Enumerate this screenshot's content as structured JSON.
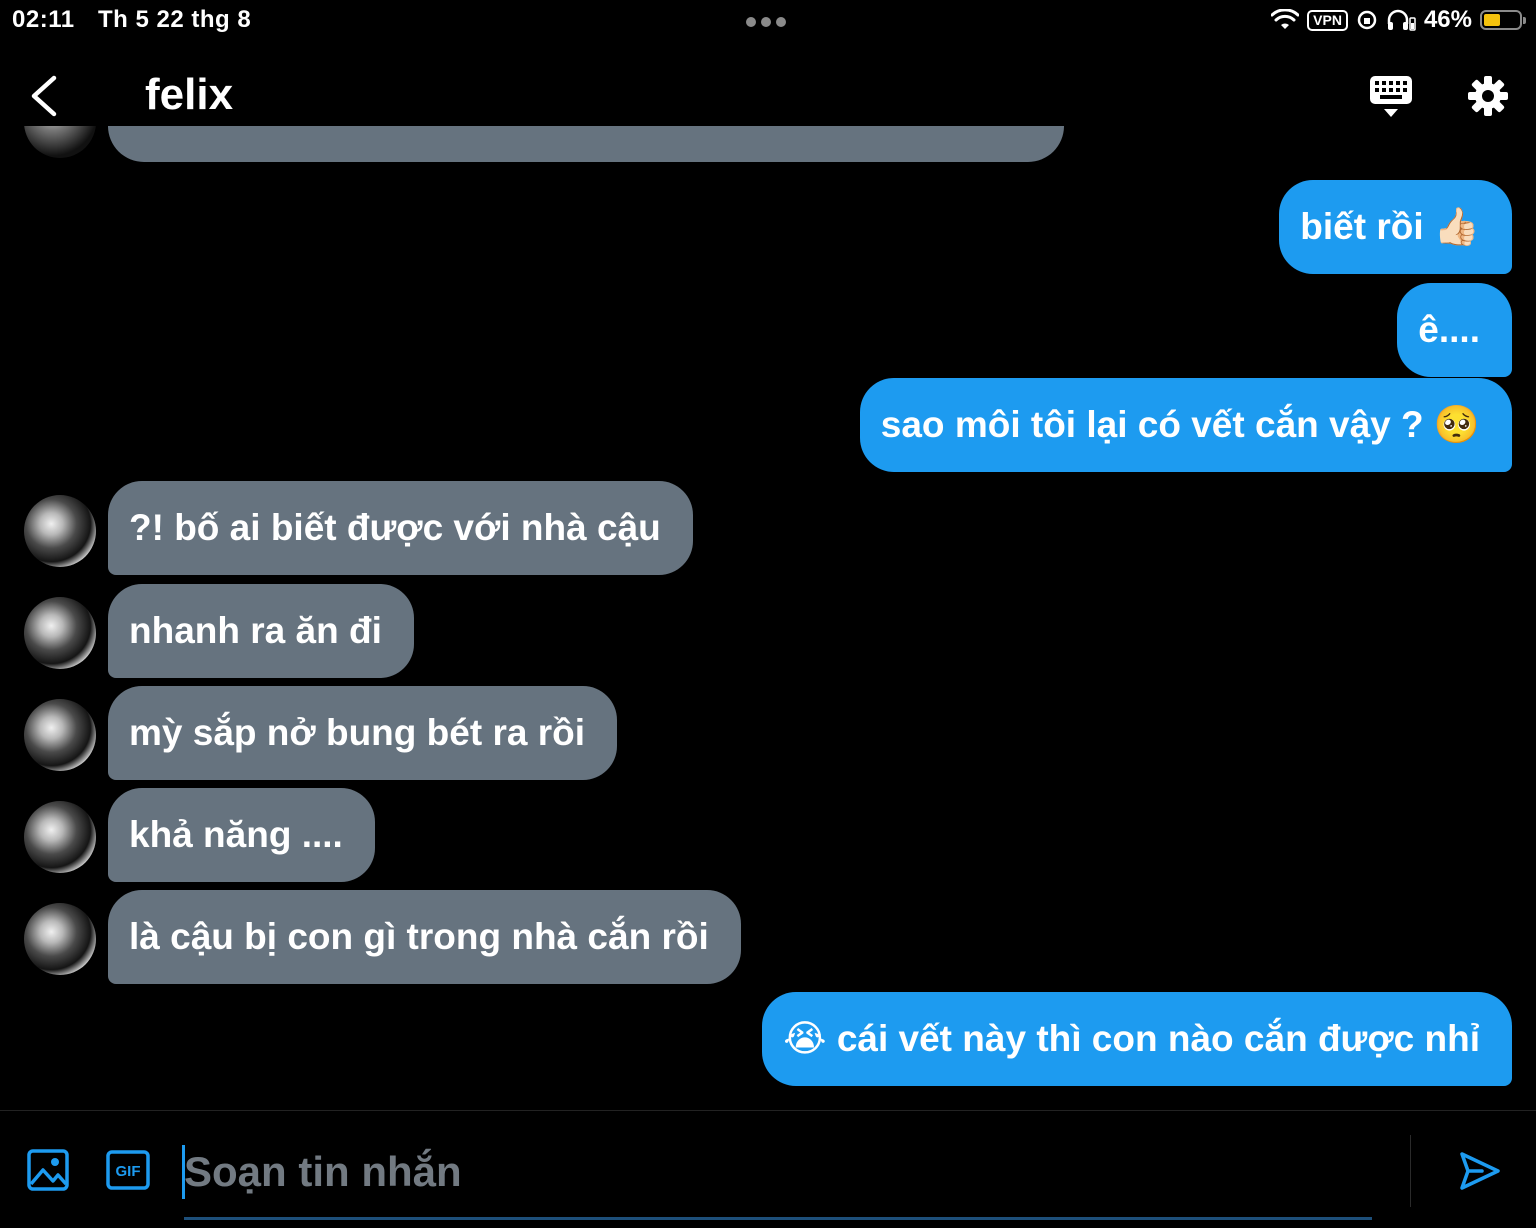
{
  "status_bar": {
    "time": "02:11",
    "date": "Th 5 22 thg 8",
    "vpn": "VPN",
    "battery_percent": "46%",
    "battery_level": 0.46
  },
  "header": {
    "title": "felix",
    "back_icon": "chevron-left-icon",
    "keyboard_icon": "keyboard-icon",
    "settings_icon": "gear-icon"
  },
  "messages": [
    {
      "direction": "out",
      "text": "biết rồi",
      "emoji": "👍🏻"
    },
    {
      "direction": "out",
      "text": "ê...."
    },
    {
      "direction": "out",
      "text": "sao môi tôi lại có vết cắn vậy ?",
      "emoji": "🥺"
    },
    {
      "direction": "in",
      "text": "?! bố ai biết được với nhà cậu"
    },
    {
      "direction": "in",
      "text": "nhanh ra ăn đi"
    },
    {
      "direction": "in",
      "text": "mỳ sắp nở bung bét ra rồi"
    },
    {
      "direction": "in",
      "text": "khả năng ...."
    },
    {
      "direction": "in",
      "text": "là cậu bị con gì trong nhà cắn rồi"
    },
    {
      "direction": "out",
      "text": "cái vết này thì con nào cắn được nhỉ",
      "emoji": "😭"
    }
  ],
  "compose": {
    "placeholder": "Soạn tin nhắn",
    "gif_label": "GIF",
    "accent": "#1d9bf0"
  },
  "colors": {
    "outgoing_bubble": "#1d9bf0",
    "incoming_bubble": "#66737f",
    "background": "#000000"
  }
}
